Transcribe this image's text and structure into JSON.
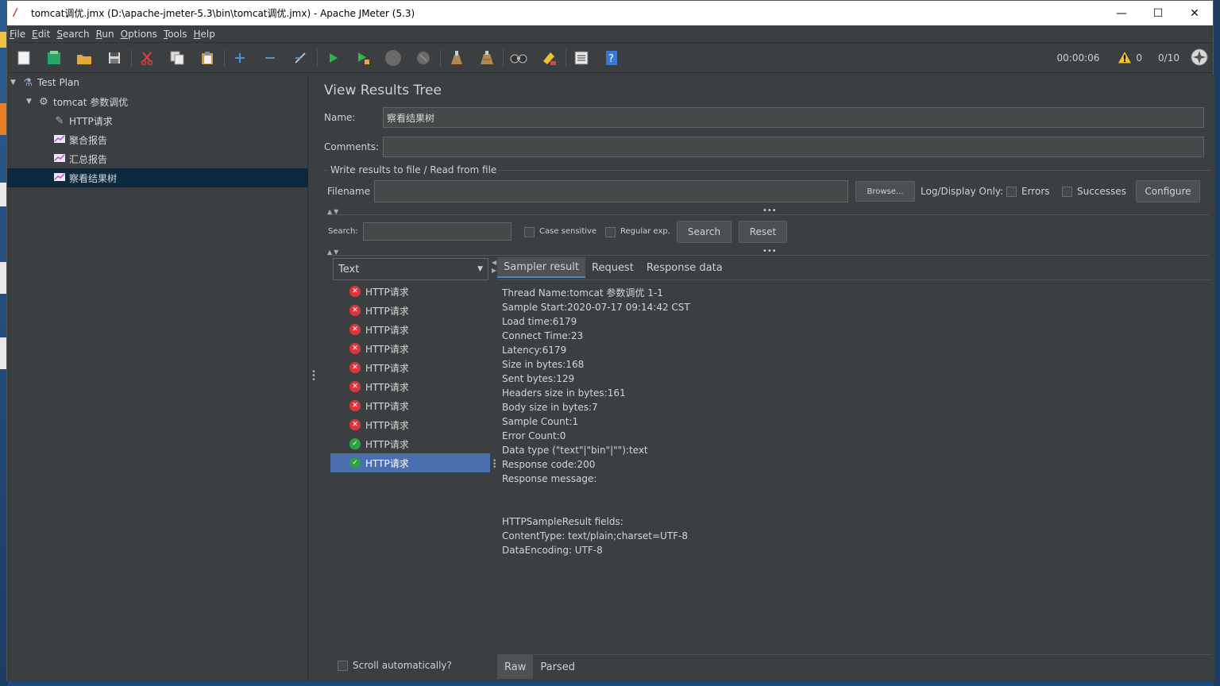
{
  "window": {
    "title": "tomcat调优.jmx (D:\\apache-jmeter-5.3\\bin\\tomcat调优.jmx) - Apache JMeter (5.3)",
    "minimize": "—",
    "maximize": "☐",
    "close": "✕"
  },
  "menu": {
    "items": [
      {
        "mnemonic": "F",
        "rest": "ile"
      },
      {
        "mnemonic": "E",
        "rest": "dit"
      },
      {
        "mnemonic": "S",
        "rest": "earch"
      },
      {
        "mnemonic": "R",
        "rest": "un"
      },
      {
        "mnemonic": "O",
        "rest": "ptions"
      },
      {
        "mnemonic": "T",
        "rest": "ools"
      },
      {
        "mnemonic": "H",
        "rest": "elp"
      }
    ]
  },
  "toolbar": {
    "icons": [
      "new-icon",
      "templates-icon",
      "open-icon",
      "save-icon",
      "cut-icon",
      "copy-icon",
      "paste-icon",
      "expand-icon",
      "collapse-icon",
      "toggle-icon",
      "start-icon",
      "start-no-pause-icon",
      "stop-icon",
      "shutdown-icon",
      "clear-icon",
      "clear-all-icon",
      "search-icon",
      "reset-search-icon",
      "function-helper-icon",
      "help-icon"
    ],
    "timer": "00:00:06",
    "warnings": "0",
    "threads": "0/10"
  },
  "tree": {
    "items": [
      {
        "label": "Test Plan",
        "icon": "flask-icon"
      },
      {
        "label": "tomcat 参数调优",
        "icon": "gear-icon"
      },
      {
        "label": "HTTP请求",
        "icon": "pipette-icon"
      },
      {
        "label": "聚合报告",
        "icon": "chart-icon"
      },
      {
        "label": "汇总报告",
        "icon": "chart-icon"
      },
      {
        "label": "察看结果树",
        "icon": "chart-icon"
      }
    ]
  },
  "panel": {
    "title": "View Results Tree",
    "name_label": "Name:",
    "name_value": "察看结果树",
    "comments_label": "Comments:",
    "comments_value": "",
    "file_group_title": "Write results to file / Read from file",
    "filename_label": "Filename",
    "filename_value": "",
    "browse_label": "Browse...",
    "log_display_label": "Log/Display Only:",
    "errors_label": "Errors",
    "successes_label": "Successes",
    "configure_label": "Configure",
    "search_label": "Search:",
    "search_value": "",
    "case_sensitive_label": "Case sensitive",
    "regex_label": "Regular exp.",
    "search_button": "Search",
    "reset_button": "Reset",
    "renderer_selected": "Text",
    "scroll_label": "Scroll automatically?"
  },
  "results": [
    {
      "label": "HTTP请求",
      "status": "fail"
    },
    {
      "label": "HTTP请求",
      "status": "fail"
    },
    {
      "label": "HTTP请求",
      "status": "fail"
    },
    {
      "label": "HTTP请求",
      "status": "fail"
    },
    {
      "label": "HTTP请求",
      "status": "fail"
    },
    {
      "label": "HTTP请求",
      "status": "fail"
    },
    {
      "label": "HTTP请求",
      "status": "fail"
    },
    {
      "label": "HTTP请求",
      "status": "fail"
    },
    {
      "label": "HTTP请求",
      "status": "ok"
    },
    {
      "label": "HTTP请求",
      "status": "ok"
    }
  ],
  "detail": {
    "tabs": [
      "Sampler result",
      "Request",
      "Response data"
    ],
    "lines": [
      "Thread Name:tomcat 参数调优 1-1",
      "Sample Start:2020-07-17 09:14:42 CST",
      "Load time:6179",
      "Connect Time:23",
      "Latency:6179",
      "Size in bytes:168",
      "Sent bytes:129",
      "Headers size in bytes:161",
      "Body size in bytes:7",
      "Sample Count:1",
      "Error Count:0",
      "Data type (\"text\"|\"bin\"|\"\"):text",
      "Response code:200",
      "Response message:",
      "",
      "",
      "HTTPSampleResult fields:",
      "ContentType: text/plain;charset=UTF-8",
      "DataEncoding: UTF-8"
    ],
    "bottom_tabs": [
      "Raw",
      "Parsed"
    ]
  }
}
